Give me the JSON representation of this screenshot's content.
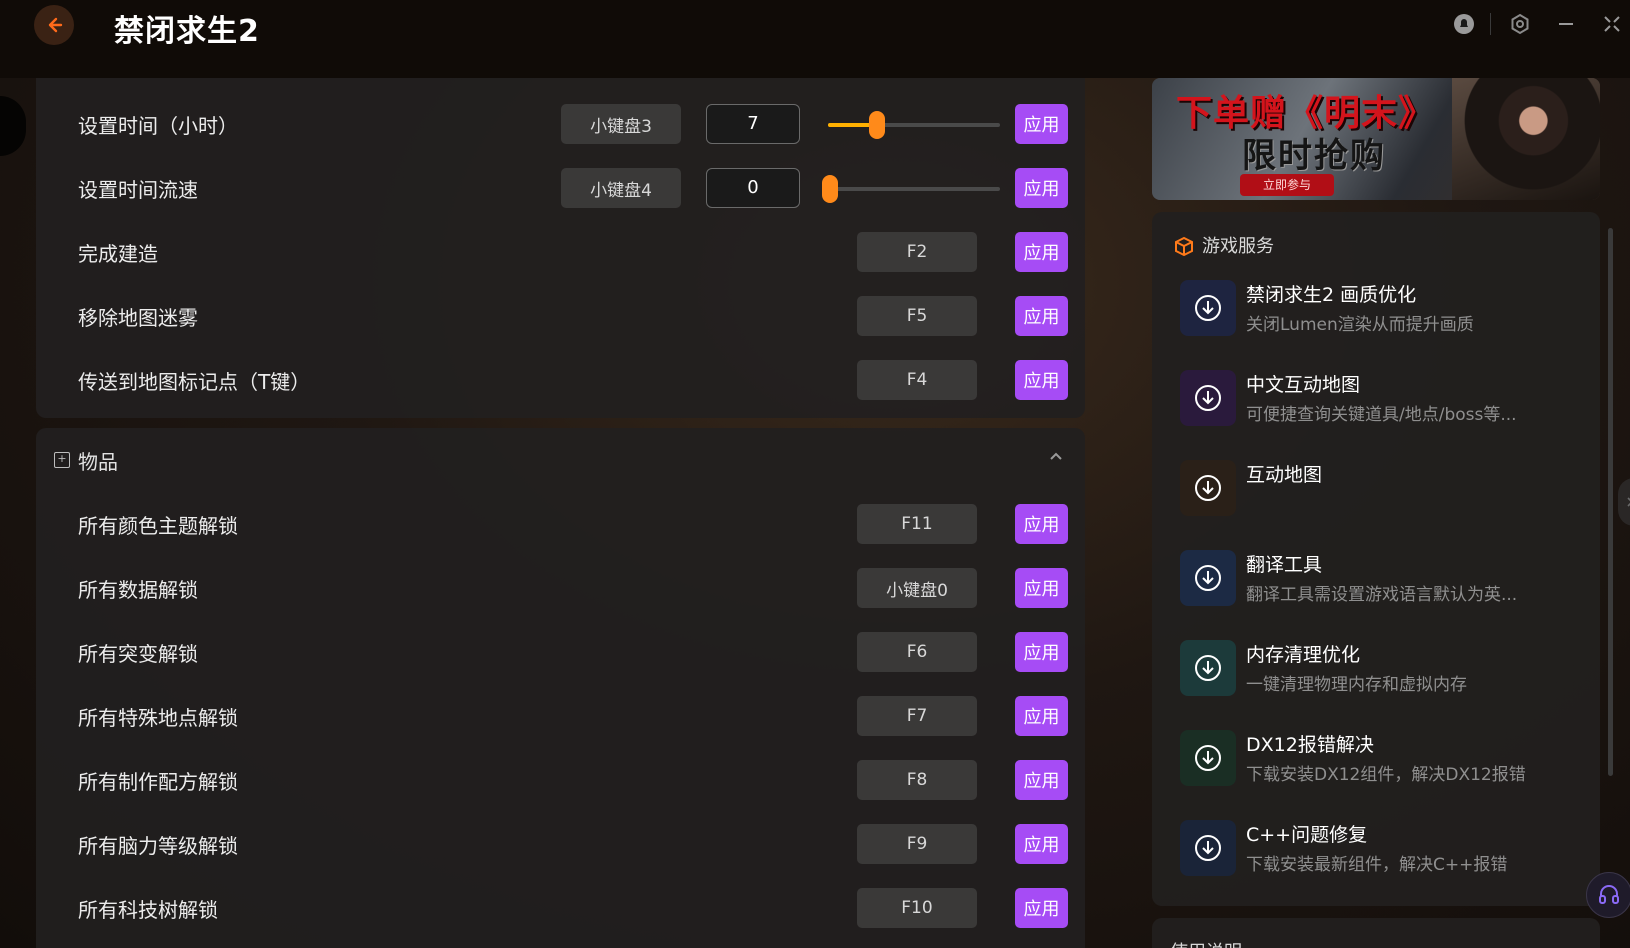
{
  "header": {
    "title": "禁闭求生2"
  },
  "cheats_top": [
    {
      "label": "设置时间（小时）",
      "hotkey": "小键盘3",
      "value": "7",
      "slider": 0.28,
      "apply": "应用"
    },
    {
      "label": "设置时间流速",
      "hotkey": "小键盘4",
      "value": "0",
      "slider": 0.0,
      "apply": "应用"
    },
    {
      "label": "完成建造",
      "hotkey": "F2",
      "apply": "应用"
    },
    {
      "label": "移除地图迷雾",
      "hotkey": "F5",
      "apply": "应用"
    },
    {
      "label": "传送到地图标记点（T键）",
      "hotkey": "F4",
      "apply": "应用"
    }
  ],
  "items_section": {
    "title": "物品",
    "rows": [
      {
        "label": "所有颜色主题解锁",
        "hotkey": "F11",
        "apply": "应用"
      },
      {
        "label": "所有数据解锁",
        "hotkey": "小键盘0",
        "apply": "应用"
      },
      {
        "label": "所有突变解锁",
        "hotkey": "F6",
        "apply": "应用"
      },
      {
        "label": "所有特殊地点解锁",
        "hotkey": "F7",
        "apply": "应用"
      },
      {
        "label": "所有制作配方解锁",
        "hotkey": "F8",
        "apply": "应用"
      },
      {
        "label": "所有脑力等级解锁",
        "hotkey": "F9",
        "apply": "应用"
      },
      {
        "label": "所有科技树解锁",
        "hotkey": "F10",
        "apply": "应用"
      }
    ]
  },
  "banner": {
    "line1": "下单赠《明末》",
    "line2": "限时抢购",
    "cta": "立即参与"
  },
  "services": {
    "title": "游戏服务",
    "items": [
      {
        "title": "禁闭求生2 画质优化",
        "desc": "关闭Lumen渲染从而提升画质",
        "color": "#1e2440"
      },
      {
        "title": "中文互动地图",
        "desc": "可便捷查询关键道具/地点/boss等...",
        "color": "#2a1a3c"
      },
      {
        "title": "互动地图",
        "desc": "",
        "color": "#2a2018"
      },
      {
        "title": "翻译工具",
        "desc": "翻译工具需设置游戏语言默认为英...",
        "color": "#1c2a44"
      },
      {
        "title": "内存清理优化",
        "desc": "一键清理物理内存和虚拟内存",
        "color": "#1c3a3a"
      },
      {
        "title": "DX12报错解决",
        "desc": "下载安装DX12组件，解决DX12报错",
        "color": "#1a2e24"
      },
      {
        "title": "C++问题修复",
        "desc": "下载安装最新组件，解决C++报错",
        "color": "#1a2438"
      }
    ]
  },
  "bottom_panel": {
    "title": "使用说明"
  },
  "colors": {
    "accent": "#a64cf5",
    "slider": "#ff8a1a",
    "back": "#ff6a1a"
  }
}
